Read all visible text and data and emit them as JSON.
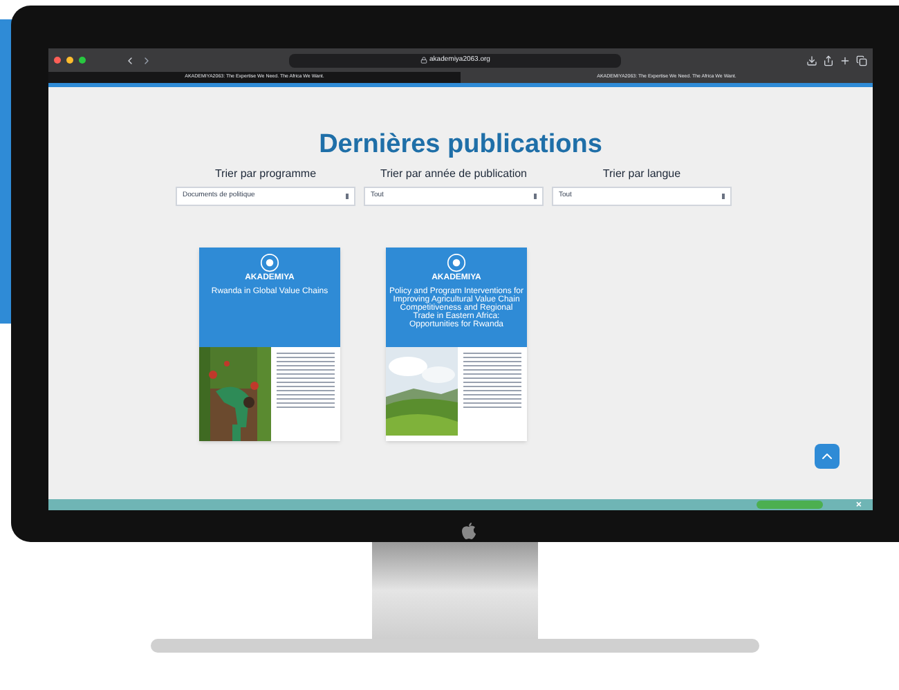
{
  "browser": {
    "address": "akademiya2063.org",
    "tabs": [
      {
        "label": "AKADEMIYA2063: The Expertise We Need. The Africa We Want.",
        "selected": true
      },
      {
        "label": "AKADEMIYA2063: The Expertise We Need. The Africa We Want.",
        "selected": false
      }
    ]
  },
  "page": {
    "title": "Dernières publications",
    "filters": [
      {
        "label": "Trier par programme",
        "value": "Documents de politique"
      },
      {
        "label": "Trier par année de publication",
        "value": "Tout"
      },
      {
        "label": "Trier par langue",
        "value": "Tout"
      }
    ],
    "publications": [
      {
        "brand": "AKADEMIYA",
        "title": "Rwanda in Global Value Chains"
      },
      {
        "brand": "AKADEMIYA",
        "title": "Policy and Program Interventions for Improving Agricultural Value Chain Competitiveness and Regional Trade in Eastern Africa: Opportunities for Rwanda"
      }
    ]
  },
  "banner": {
    "close": "×"
  }
}
